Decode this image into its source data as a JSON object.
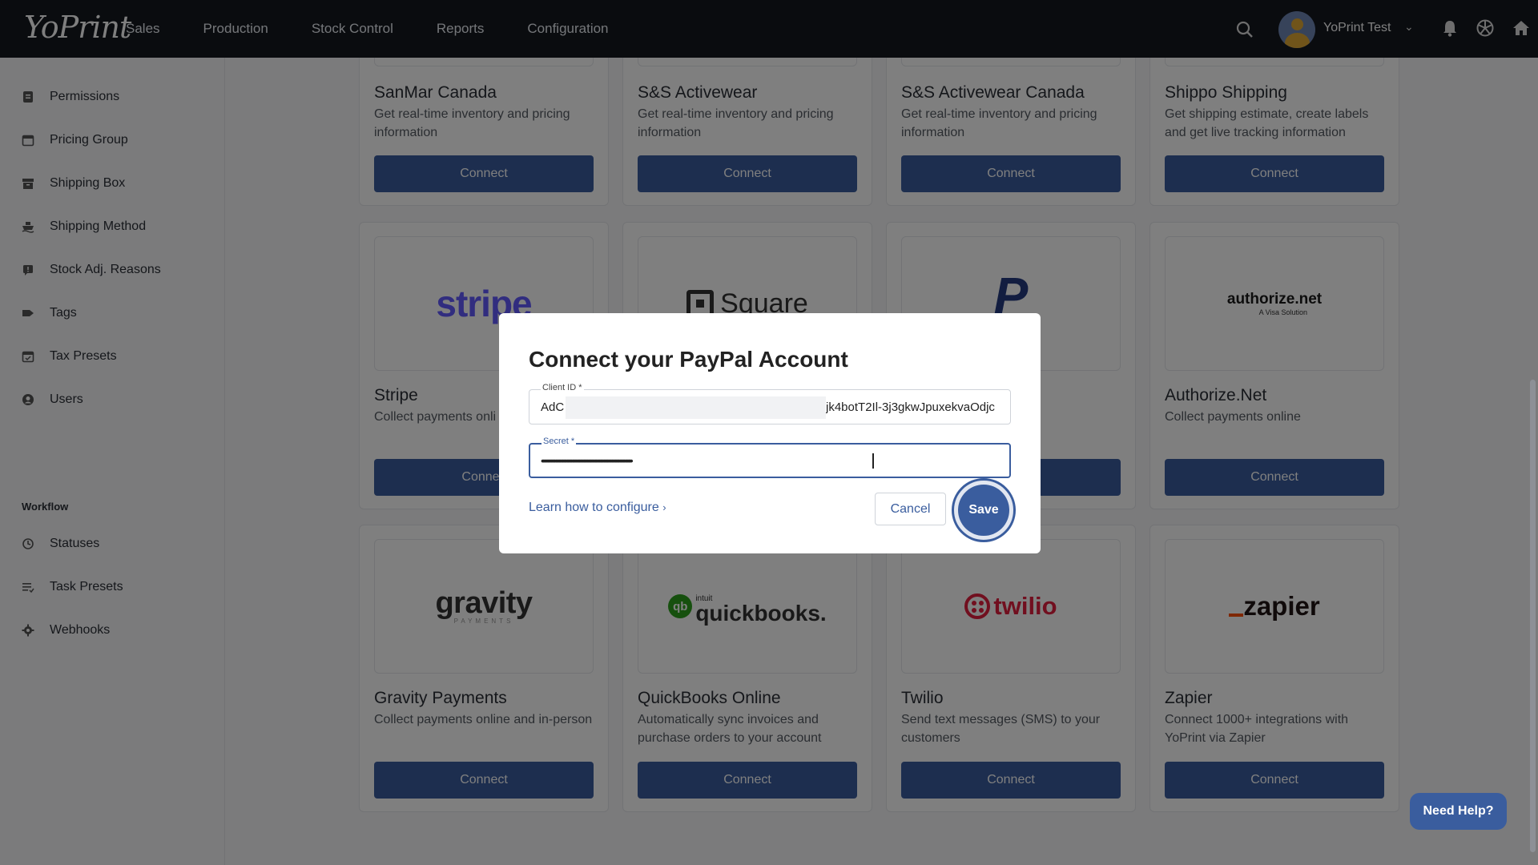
{
  "app": {
    "logo": "YoPrint"
  },
  "nav": [
    "Sales",
    "Production",
    "Stock Control",
    "Reports",
    "Configuration"
  ],
  "user": {
    "name": "YoPrint Test"
  },
  "sidebar": {
    "items": [
      {
        "label": "Permissions",
        "icon": "clipboard-icon"
      },
      {
        "label": "Pricing Group",
        "icon": "calendar-icon"
      },
      {
        "label": "Shipping Box",
        "icon": "box-icon"
      },
      {
        "label": "Shipping Method",
        "icon": "ship-icon"
      },
      {
        "label": "Stock Adj. Reasons",
        "icon": "flag-icon"
      },
      {
        "label": "Tags",
        "icon": "tag-icon"
      },
      {
        "label": "Tax Presets",
        "icon": "calendar-check-icon"
      },
      {
        "label": "Users",
        "icon": "user-circle-icon"
      }
    ],
    "workflow_title": "Workflow",
    "workflow_items": [
      {
        "label": "Statuses",
        "icon": "status-icon"
      },
      {
        "label": "Task Presets",
        "icon": "list-icon"
      },
      {
        "label": "Webhooks",
        "icon": "gear-icon"
      }
    ]
  },
  "cards_top": [
    {
      "title": "SanMar Canada",
      "desc": "Get real-time inventory and pricing information",
      "btn": "Connect"
    },
    {
      "title": "S&S Activewear",
      "desc": "Get real-time inventory and pricing information",
      "btn": "Connect"
    },
    {
      "title": "S&S Activewear Canada",
      "desc": "Get real-time inventory and pricing information",
      "btn": "Connect"
    },
    {
      "title": "Shippo Shipping",
      "desc": "Get shipping estimate, create labels and get live tracking information",
      "btn": "Connect"
    }
  ],
  "cards_mid": [
    {
      "title": "Stripe",
      "desc": "Collect payments onli",
      "btn": "Connec",
      "logo": "stripe"
    },
    {
      "title": "",
      "desc": "",
      "btn": "",
      "logo": "Square"
    },
    {
      "title": "",
      "desc": "",
      "btn": "",
      "logo": "P"
    },
    {
      "title": "Authorize.Net",
      "desc": "Collect payments online",
      "btn": "Connect",
      "logo": "authorize.net",
      "logo_sub": "A Visa Solution"
    }
  ],
  "cards_bottom": [
    {
      "title": "Gravity Payments",
      "desc": "Collect payments online and in-person",
      "btn": "Connect",
      "logo": "gravity",
      "logo_sub": "PAYMENTS"
    },
    {
      "title": "QuickBooks Online",
      "desc": "Automatically sync invoices and purchase orders to your account",
      "btn": "Connect",
      "logo": "quickbooks.",
      "logo_sub": "intuit"
    },
    {
      "title": "Twilio",
      "desc": "Send text messages (SMS) to your customers",
      "btn": "Connect",
      "logo": "twilio"
    },
    {
      "title": "Zapier",
      "desc": "Connect 1000+ integrations with YoPrint via Zapier",
      "btn": "Connect",
      "logo": "zapier"
    }
  ],
  "modal": {
    "title": "Connect your PayPal Account",
    "client_id_label": "Client ID *",
    "client_id_prefix": "AdC",
    "client_id_suffix": "jk4botT2Il-3j3gkwJpuxekvaOdjc",
    "secret_label": "Secret *",
    "secret_value": "••••••••••••••••••••••••••••••••••••••••••••••••••••••••••••••••••••••••••••••••",
    "learn_link": "Learn how to configure",
    "cancel": "Cancel",
    "save": "Save"
  },
  "help": "Need Help?",
  "colors": {
    "primary": "#3a5d9e",
    "topbar": "#14181f",
    "stripe": "#635bff",
    "twilio": "#e31e3e",
    "paypal": "#253b80"
  }
}
